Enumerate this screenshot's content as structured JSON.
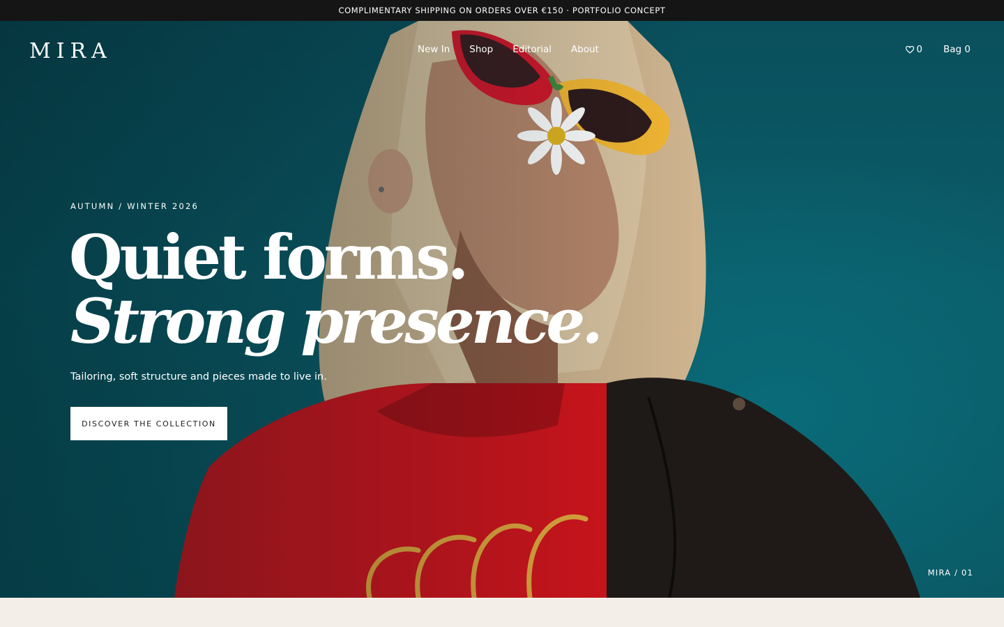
{
  "announcement": "COMPLIMENTARY SHIPPING ON ORDERS OVER €150 · PORTFOLIO CONCEPT",
  "brand": {
    "logo": "MIRA"
  },
  "nav": {
    "items": [
      {
        "label": "New In"
      },
      {
        "label": "Shop"
      },
      {
        "label": "Editorial"
      },
      {
        "label": "About"
      }
    ]
  },
  "utility": {
    "wishlist_count": "0",
    "bag_label": "Bag 0",
    "wishlist_icon": "heart-icon"
  },
  "hero": {
    "eyebrow": "AUTUMN / WINTER 2026",
    "headline_line1": "Quiet forms.",
    "headline_line2": "Strong presence.",
    "subcopy": "Tailoring, soft structure and pieces made to live in.",
    "cta_label": "DISCOVER THE COLLECTION",
    "slide_counter": "MIRA / 01",
    "image_description_colors": {
      "background": "#0b5d6a",
      "shirt": "#d8141c",
      "jacket": "#1f1a17",
      "hair": "#d9c3a0"
    }
  }
}
